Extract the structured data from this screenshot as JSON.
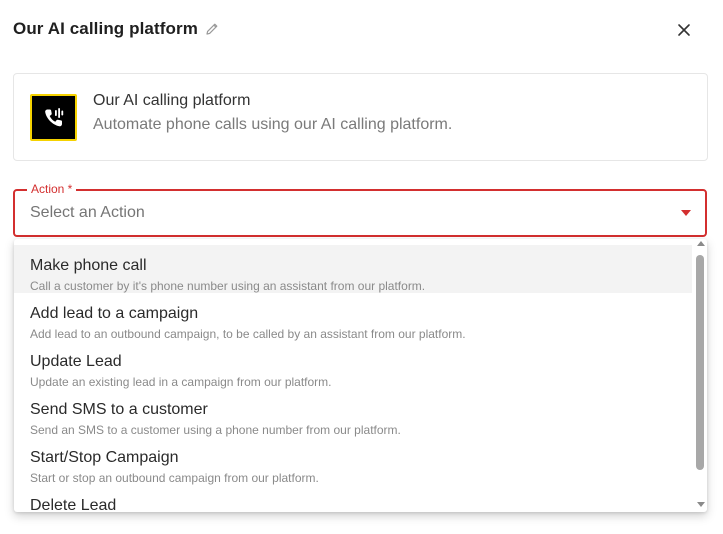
{
  "header": {
    "title": "Our AI calling platform",
    "edit_icon": "pencil-icon",
    "close_icon": "close-icon"
  },
  "app_card": {
    "name": "Our AI calling platform",
    "description": "Automate phone calls using our AI calling platform.",
    "logo_icon": "phone-call-icon"
  },
  "action_field": {
    "label": "Action *",
    "placeholder": "Select an Action",
    "required": true,
    "caret_icon": "caret-down-icon"
  },
  "dropdown": {
    "options": [
      {
        "title": "Make phone call",
        "description": "Call a customer by it's phone number using an assistant from our platform."
      },
      {
        "title": "Add lead to a campaign",
        "description": "Add lead to an outbound campaign, to be called by an assistant from our platform."
      },
      {
        "title": "Update Lead",
        "description": "Update an existing lead in a campaign from our platform."
      },
      {
        "title": "Send SMS to a customer",
        "description": "Send an SMS to a customer using a phone number from our platform."
      },
      {
        "title": "Start/Stop Campaign",
        "description": "Start or stop an outbound campaign from our platform."
      },
      {
        "title": "Delete Lead",
        "description": ""
      }
    ],
    "highlighted_index": 0
  },
  "colors": {
    "error_accent": "#d32f2f",
    "logo_bg": "#000000",
    "logo_border": "#f5d200",
    "highlight_bg": "#f3f3f3"
  }
}
